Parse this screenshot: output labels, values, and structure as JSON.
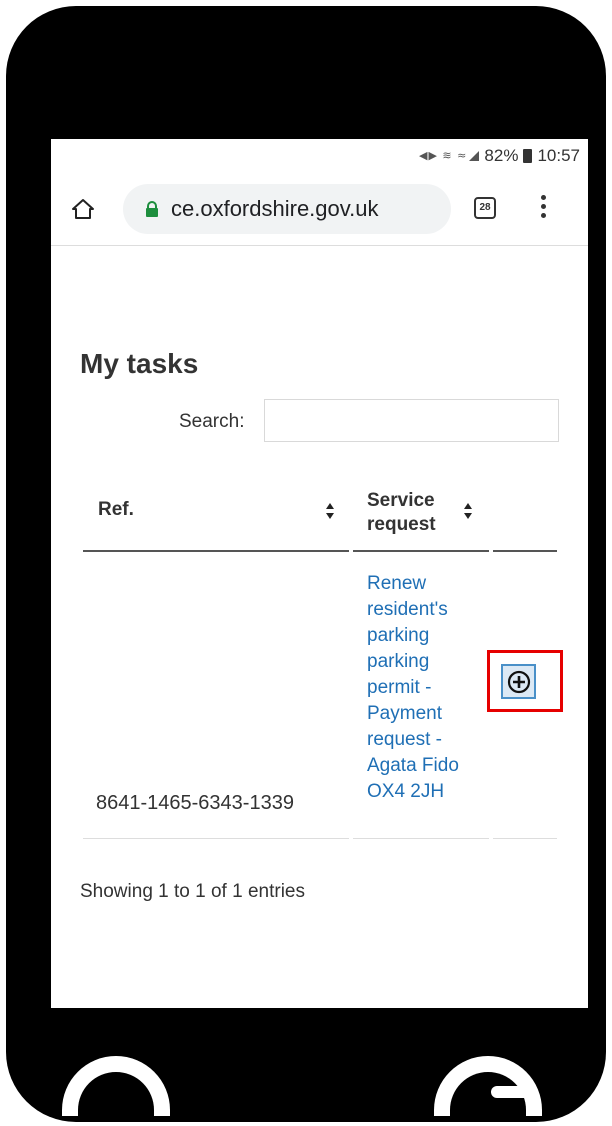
{
  "status_bar": {
    "icons": "◀◆ ▲",
    "battery_percent": "82%",
    "time": "10:57"
  },
  "browser": {
    "url": "ce.oxfordshire.gov.uk",
    "tab_count": "28"
  },
  "page": {
    "title": "My tasks",
    "search_label": "Search:",
    "search_value": ""
  },
  "table": {
    "columns": [
      "Ref.",
      "Service request"
    ],
    "rows": [
      {
        "ref": "8641-1465-6343-1339",
        "service_request": "Renew resident's parking parking permit - Payment request - Agata Fido OX4 2JH"
      }
    ]
  },
  "footer": {
    "info": "Showing 1 to 1 of 1 entries"
  },
  "colors": {
    "link": "#1f6fb5",
    "highlight": "#e60000",
    "secure_lock": "#1e8e3e"
  }
}
